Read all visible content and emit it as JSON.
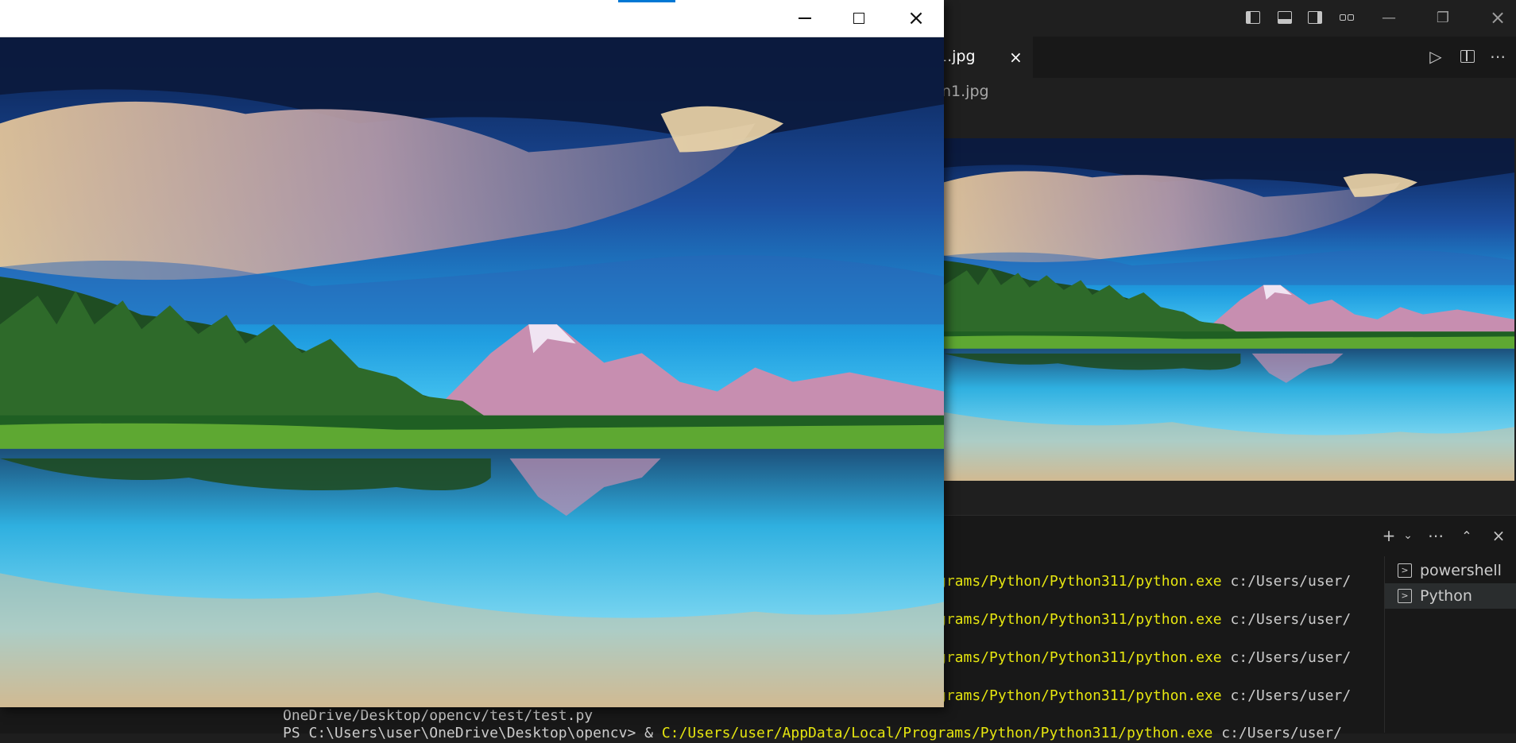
{
  "vscode": {
    "editor_tab": {
      "label": "1.jpg"
    },
    "breadcrumb": "n1.jpg",
    "terminal": {
      "lines": [
        {
          "path": "grams/Python/Python311/python.exe",
          "arg": " c:/Users/user/"
        },
        {
          "path": "grams/Python/Python311/python.exe",
          "arg": " c:/Users/user/"
        },
        {
          "path": "grams/Python/Python311/python.exe",
          "arg": " c:/Users/user/"
        },
        {
          "path": "grams/Python/Python311/python.exe",
          "arg": " c:/Users/user/"
        }
      ],
      "bottom_line_1": "OneDrive/Desktop/opencv/test/test.py",
      "bottom_line_2_prefix": "PS C:\\Users\\user\\OneDrive\\Desktop\\opencv> & ",
      "bottom_line_2_path": "C:/Users/user/AppData/Local/Programs/Python/Python311/python.exe",
      "bottom_line_2_arg": " c:/Users/user/",
      "instances": [
        {
          "label": "powershell",
          "active": false
        },
        {
          "label": "Python",
          "active": true
        }
      ]
    }
  },
  "icons": {
    "close": "×",
    "minimize": "—",
    "maximize": "☐",
    "restore": "❐",
    "run": "▷",
    "more": "⋯",
    "add": "+",
    "chevron_down": "⌄",
    "chevron_up": "⌃"
  }
}
